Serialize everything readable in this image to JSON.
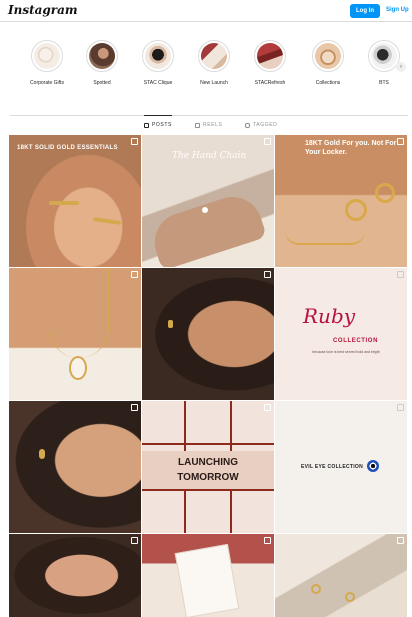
{
  "header": {
    "logo": "Instagram",
    "login_label": "Log In",
    "signup_label": "Sign Up"
  },
  "highlights": [
    {
      "label": "Corporate Gifts"
    },
    {
      "label": "Spotted"
    },
    {
      "label": "STAC Clique"
    },
    {
      "label": "New Launch"
    },
    {
      "label": "STACRefresh"
    },
    {
      "label": "Collections"
    },
    {
      "label": "BTS"
    }
  ],
  "tabs": [
    {
      "label": "POSTS",
      "icon": "grid-icon",
      "active": true
    },
    {
      "label": "REELS",
      "icon": "reels-icon",
      "active": false
    },
    {
      "label": "TAGGED",
      "icon": "tagged-icon",
      "active": false
    }
  ],
  "posts": [
    {
      "overlay": "18KT SOLID GOLD ESSENTIALS",
      "type_icon": "carousel-icon"
    },
    {
      "overlay": "The Hand Chain",
      "type_icon": "reel-icon"
    },
    {
      "overlay": "18KT Gold For you. Not For Your Locker.",
      "type_icon": "carousel-icon"
    },
    {
      "overlay": "",
      "type_icon": "reel-icon"
    },
    {
      "overlay": "",
      "type_icon": "reel-icon"
    },
    {
      "overlay_title": "Ruby",
      "overlay_sub": "COLLECTION",
      "overlay_note": "because love is best served bold and bright",
      "type_icon": "carousel-icon"
    },
    {
      "overlay": "",
      "type_icon": "reel-icon"
    },
    {
      "overlay_line1": "LAUNCHING",
      "overlay_line2": "TOMORROW",
      "type_icon": "carousel-icon"
    },
    {
      "overlay": "EVIL EYE COLLECTION",
      "type_icon": "carousel-icon"
    },
    {
      "overlay": "",
      "type_icon": "reel-icon"
    },
    {
      "overlay": "",
      "type_icon": "carousel-icon"
    },
    {
      "overlay": "",
      "type_icon": "carousel-icon"
    }
  ],
  "colors": {
    "accent": "#0095f6",
    "border": "#dbdbdb",
    "ruby": "#b5123f"
  }
}
